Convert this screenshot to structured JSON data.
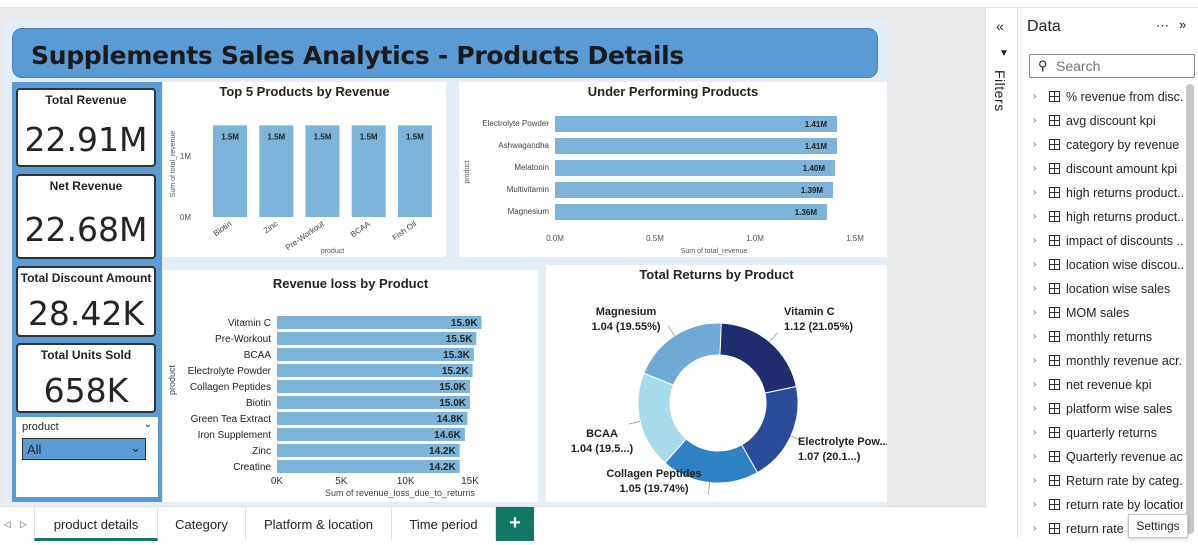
{
  "report": {
    "title": "Supplements Sales Analytics - Products Details"
  },
  "kpis": [
    {
      "label": "Total Revenue",
      "value": "22.91M"
    },
    {
      "label": "Net Revenue",
      "value": "22.68M"
    },
    {
      "label": "Total Discount Amount",
      "value": "28.42K"
    },
    {
      "label": "Total Units Sold",
      "value": "658K"
    }
  ],
  "slicer": {
    "label": "product",
    "selected": "All"
  },
  "chart_data": [
    {
      "type": "bar",
      "title": "Top 5 Products by Revenue",
      "xlabel": "product",
      "ylabel": "Sum of total_revenue",
      "categories": [
        "Biotin",
        "Zinc",
        "Pre-Workout",
        "BCAA",
        "Fish Oil"
      ],
      "values": [
        1.5,
        1.5,
        1.5,
        1.5,
        1.5
      ],
      "data_labels": [
        "1.5M",
        "1.5M",
        "1.5M",
        "1.5M",
        "1.5M"
      ],
      "yticks": [
        "0M",
        "1M"
      ],
      "ylim": [
        0,
        1.75
      ],
      "color": "#7cb4da"
    },
    {
      "type": "bar",
      "orientation": "horizontal",
      "title": "Under Performing Products",
      "xlabel": "Sum of total_revenue",
      "ylabel": "product",
      "categories": [
        "Electrolyte Powder",
        "Ashwagandha",
        "Melatonin",
        "Multivitamin",
        "Magnesium"
      ],
      "values": [
        1.41,
        1.41,
        1.4,
        1.39,
        1.36
      ],
      "data_labels": [
        "1.41M",
        "1.41M",
        "1.40M",
        "1.39M",
        "1.36M"
      ],
      "xticks": [
        "0.0M",
        "0.5M",
        "1.0M",
        "1.5M"
      ],
      "xlim": [
        0,
        1.5
      ],
      "color": "#7cb4da"
    },
    {
      "type": "bar",
      "orientation": "horizontal",
      "title": "Revenue loss by Product",
      "xlabel": "Sum of revenue_loss_due_to_returns",
      "ylabel": "product",
      "categories": [
        "Vitamin C",
        "Pre-Workout",
        "BCAA",
        "Electrolyte Powder",
        "Collagen Peptides",
        "Biotin",
        "Green Tea Extract",
        "Iron Supplement",
        "Zinc",
        "Creatine"
      ],
      "values": [
        15.9,
        15.5,
        15.3,
        15.2,
        15.0,
        15.0,
        14.8,
        14.6,
        14.2,
        14.2
      ],
      "data_labels": [
        "15.9K",
        "15.5K",
        "15.3K",
        "15.2K",
        "15.0K",
        "15.0K",
        "14.8K",
        "14.6K",
        "14.2K",
        "14.2K"
      ],
      "xticks": [
        "0K",
        "5K",
        "10K",
        "15K"
      ],
      "xlim": [
        0,
        15
      ],
      "color": "#7cb4da"
    },
    {
      "type": "pie",
      "donut": true,
      "title": "Total Returns by Product",
      "slices": [
        {
          "name": "Vitamin C",
          "value": 1.12,
          "label": "1.12 (21.05%)",
          "color": "#1f2d6e"
        },
        {
          "name": "Electrolyte Pow...",
          "value": 1.07,
          "label": "1.07 (20.1...)",
          "color": "#2a4c9a"
        },
        {
          "name": "Collagen Peptides",
          "value": 1.05,
          "label": "1.05 (19.74%)",
          "color": "#2e82c4"
        },
        {
          "name": "BCAA",
          "value": 1.04,
          "label": "1.04 (19.5...)",
          "color": "#a7dbeb"
        },
        {
          "name": "Magnesium",
          "value": 1.04,
          "label": "1.04 (19.55%)",
          "color": "#6fa9d6"
        }
      ]
    }
  ],
  "filters_pane": {
    "label": "Filters",
    "collapse_icon": "double-chevron-left-icon"
  },
  "data_pane": {
    "title": "Data",
    "more_icon": "ellipsis-icon",
    "expand_icon": "double-chevron-right-icon",
    "search_placeholder": "Search",
    "fields": [
      "% revenue from disc...",
      "avg discount kpi",
      "category by revenue",
      "discount amount kpi",
      "high returns product...",
      "high returns product...",
      "impact of discounts ...",
      "location wise discou...",
      "location wise sales",
      "MOM sales",
      "monthly returns",
      "monthly revenue acr...",
      "net revenue kpi",
      "platform wise sales",
      "quarterly returns",
      "Quarterly revenue ac...",
      "Return rate by categ...",
      "return rate by location",
      "return rate l..."
    ]
  },
  "tooltip": "Settings",
  "tabs": [
    {
      "label": "product details",
      "active": true
    },
    {
      "label": "Category",
      "active": false
    },
    {
      "label": "Platform & location",
      "active": false
    },
    {
      "label": "Time period",
      "active": false
    }
  ],
  "add_tab_label": "+"
}
